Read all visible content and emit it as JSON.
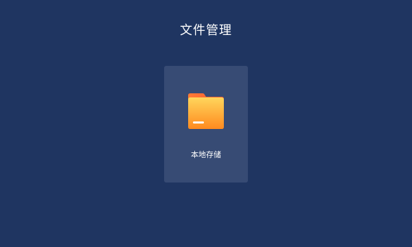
{
  "header": {
    "title": "文件管理"
  },
  "storage": {
    "items": [
      {
        "label": "本地存储",
        "icon": "folder-icon"
      }
    ]
  },
  "colors": {
    "background": "#1f3561",
    "card": "#374b74",
    "folder_front_top": "#ffcb4f",
    "folder_front_bottom": "#ff8a1f",
    "folder_back": "#f5623a",
    "text": "#ffffff"
  }
}
